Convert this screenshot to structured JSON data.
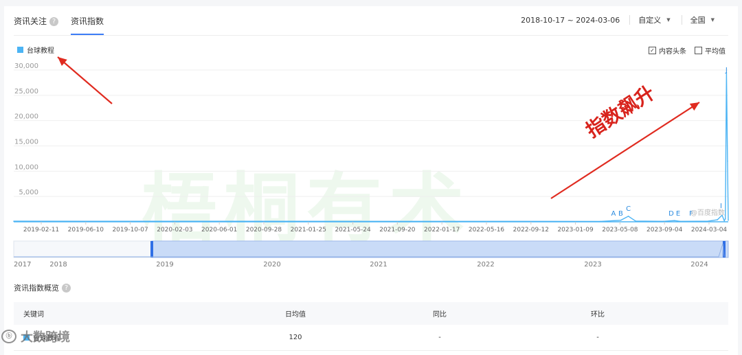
{
  "tabs": [
    {
      "label": "资讯关注",
      "active": false
    },
    {
      "label": "资讯指数",
      "active": true
    }
  ],
  "filters": {
    "date_range": "2018-10-17 ~ 2024-03-06",
    "period": "自定义",
    "region": "全国"
  },
  "legend": {
    "keyword": "台球教程",
    "color": "#4cb4f4"
  },
  "options": [
    {
      "label": "内容头条",
      "checked": true
    },
    {
      "label": "平均值",
      "checked": false
    }
  ],
  "watermark": "梧桐有术",
  "annotation": "指数飙升",
  "chart_data": {
    "type": "line",
    "series": [
      {
        "name": "台球教程",
        "color": "#4cb4f4",
        "points": [
          [
            "2018-10-17",
            120
          ],
          [
            "2023-03-20",
            80
          ],
          [
            "2023-05-15",
            300
          ],
          [
            "2023-06-05",
            1100
          ],
          [
            "2023-06-25",
            150
          ],
          [
            "2023-09-10",
            90
          ],
          [
            "2023-10-10",
            250
          ],
          [
            "2023-10-25",
            100
          ],
          [
            "2024-01-10",
            120
          ],
          [
            "2024-02-05",
            400
          ],
          [
            "2024-02-18",
            1300
          ],
          [
            "2024-02-24",
            200
          ],
          [
            "2024-02-27",
            600
          ],
          [
            "2024-03-01",
            29500
          ],
          [
            "2024-03-04",
            12000
          ],
          [
            "2024-03-06",
            300
          ]
        ]
      }
    ],
    "y_ticks": [
      "5,000",
      "10,000",
      "15,000",
      "20,000",
      "25,000",
      "30,000"
    ],
    "ylim": [
      0,
      30000
    ],
    "x_ticks": [
      "2019-02-11",
      "2019-06-10",
      "2019-10-07",
      "2020-02-03",
      "2020-06-01",
      "2020-09-28",
      "2021-01-25",
      "2021-05-24",
      "2021-09-20",
      "2022-01-17",
      "2022-05-16",
      "2022-09-12",
      "2023-01-09",
      "2023-05-08",
      "2023-09-04",
      "2024-03-04"
    ],
    "xlim": [
      "2018-10-17",
      "2024-03-06"
    ],
    "event_markers": [
      {
        "label": "A",
        "date": "2023-04-25"
      },
      {
        "label": "B",
        "date": "2023-05-15"
      },
      {
        "label": "C",
        "date": "2023-06-05"
      },
      {
        "label": "D",
        "date": "2023-10-01"
      },
      {
        "label": "E",
        "date": "2023-10-20"
      },
      {
        "label": "F",
        "date": "2023-11-25"
      },
      {
        "label": "I",
        "date": "2024-02-15"
      },
      {
        "label": "J",
        "date": "2024-03-01"
      }
    ],
    "source_watermark": "@百度指数",
    "range_years": [
      "2017",
      "2018",
      "2019",
      "2020",
      "2021",
      "2022",
      "2023",
      "2024"
    ],
    "grid": true
  },
  "overview": {
    "title": "资讯指数概览",
    "columns": [
      "关键词",
      "日均值",
      "同比",
      "环比"
    ],
    "rows": [
      {
        "keyword": "台球教程",
        "daily_avg": "120",
        "yoy": "-",
        "mom": "-"
      }
    ]
  },
  "footer_watermark": "大数跨境"
}
